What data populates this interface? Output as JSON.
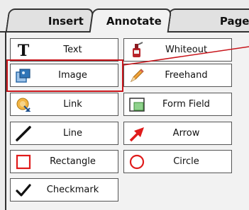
{
  "tabs": [
    {
      "label": "Insert",
      "state": "inactive"
    },
    {
      "label": "Annotate",
      "state": "active"
    },
    {
      "label": "Page",
      "state": "inactive"
    }
  ],
  "tools": {
    "text": {
      "label": "Text",
      "icon": "text-T-icon"
    },
    "whiteout": {
      "label": "Whiteout",
      "icon": "whiteout-bottle-icon"
    },
    "image": {
      "label": "Image",
      "icon": "image-icon",
      "highlighted": true
    },
    "freehand": {
      "label": "Freehand",
      "icon": "pencil-icon"
    },
    "link": {
      "label": "Link",
      "icon": "link-icon"
    },
    "form_field": {
      "label": "Form Field",
      "icon": "form-field-icon"
    },
    "line": {
      "label": "Line",
      "icon": "line-icon"
    },
    "arrow": {
      "label": "Arrow",
      "icon": "arrow-icon"
    },
    "rectangle": {
      "label": "Rectangle",
      "icon": "rectangle-icon"
    },
    "circle": {
      "label": "Circle",
      "icon": "circle-icon"
    },
    "checkmark": {
      "label": "Checkmark",
      "icon": "checkmark-icon"
    }
  },
  "colors": {
    "highlight": "#c8151b",
    "tab_active_bg": "#f2f2f2",
    "tab_inactive_bg": "#e1e1e1"
  }
}
